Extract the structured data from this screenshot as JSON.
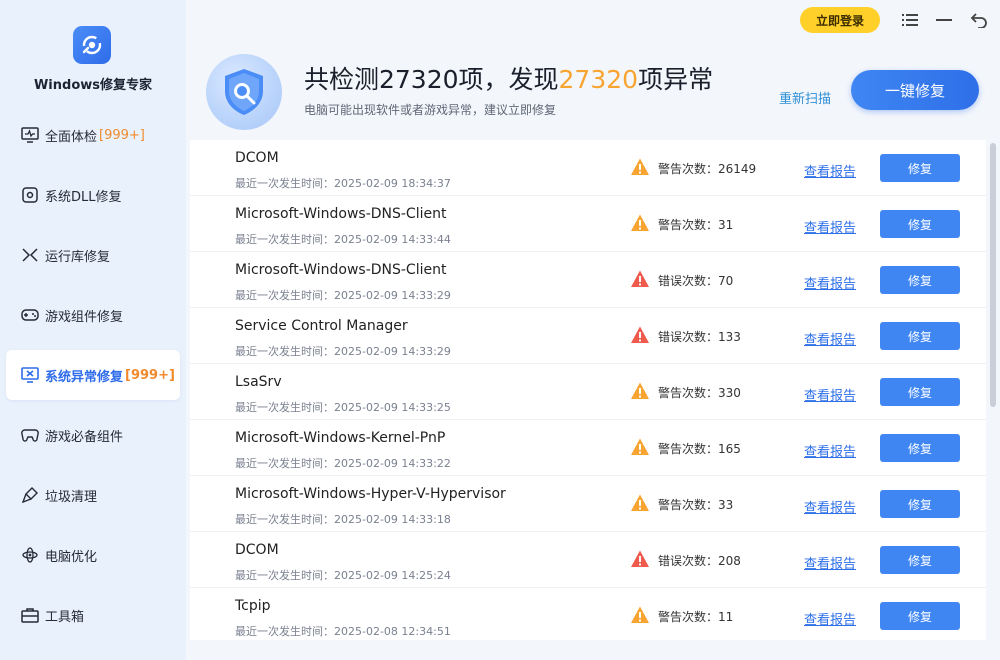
{
  "app": {
    "title": "Windows修复专家"
  },
  "topbar": {
    "login_label": "立即登录"
  },
  "sidebar": {
    "items": [
      {
        "label": "全面体检",
        "badge": "[999+]",
        "icon": "monitor-pulse-icon"
      },
      {
        "label": "系统DLL修复",
        "badge": "",
        "icon": "dll-gear-icon"
      },
      {
        "label": "运行库修复",
        "badge": "",
        "icon": "runtime-icon"
      },
      {
        "label": "游戏组件修复",
        "badge": "",
        "icon": "gamepad-icon"
      },
      {
        "label": "系统异常修复",
        "badge": "[999+]",
        "icon": "monitor-x-icon",
        "active": true
      },
      {
        "label": "游戏必备组件",
        "badge": "",
        "icon": "controller-icon"
      },
      {
        "label": "垃圾清理",
        "badge": "",
        "icon": "broom-icon"
      },
      {
        "label": "电脑优化",
        "badge": "",
        "icon": "atom-icon"
      },
      {
        "label": "工具箱",
        "badge": "",
        "icon": "toolbox-icon"
      }
    ]
  },
  "header": {
    "headline_prefix": "共检测27320项，发现",
    "headline_highlight": "27320",
    "headline_suffix": "项异常",
    "subline": "电脑可能出现软件或者游戏异常，建议立即修复",
    "rescan_label": "重新扫描",
    "fix_all_label": "一键修复"
  },
  "list": {
    "report_label": "查看报告",
    "repair_label": "修复",
    "rows": [
      {
        "name": "DCOM",
        "time": "最近一次发生时间：2025-02-09 18:34:37",
        "level": "warning",
        "count": "警告次数：26149"
      },
      {
        "name": "Microsoft-Windows-DNS-Client",
        "time": "最近一次发生时间：2025-02-09 14:33:44",
        "level": "warning",
        "count": "警告次数：31"
      },
      {
        "name": "Microsoft-Windows-DNS-Client",
        "time": "最近一次发生时间：2025-02-09 14:33:29",
        "level": "error",
        "count": "错误次数：70"
      },
      {
        "name": "Service Control Manager",
        "time": "最近一次发生时间：2025-02-09 14:33:29",
        "level": "error",
        "count": "错误次数：133"
      },
      {
        "name": "LsaSrv",
        "time": "最近一次发生时间：2025-02-09 14:33:25",
        "level": "warning",
        "count": "警告次数：330"
      },
      {
        "name": "Microsoft-Windows-Kernel-PnP",
        "time": "最近一次发生时间：2025-02-09 14:33:22",
        "level": "warning",
        "count": "警告次数：165"
      },
      {
        "name": "Microsoft-Windows-Hyper-V-Hypervisor",
        "time": "最近一次发生时间：2025-02-09 14:33:18",
        "level": "warning",
        "count": "警告次数：33"
      },
      {
        "name": "DCOM",
        "time": "最近一次发生时间：2025-02-09 14:25:24",
        "level": "error",
        "count": "错误次数：208"
      },
      {
        "name": "Tcpip",
        "time": "最近一次发生时间：2025-02-08 12:34:51",
        "level": "warning",
        "count": "警告次数：11"
      }
    ]
  },
  "colors": {
    "accent": "#3f86f3",
    "warning": "#f7a431",
    "error": "#ef5a4c",
    "badge": "#f08a2c"
  }
}
